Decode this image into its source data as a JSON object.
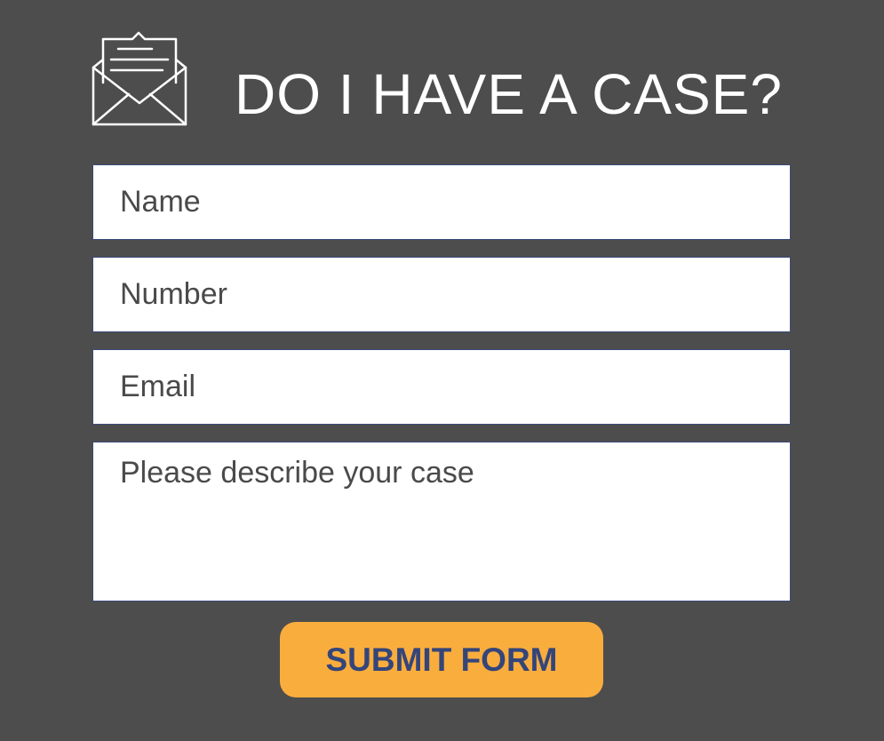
{
  "header": {
    "title": "DO I HAVE A CASE?",
    "icon": "open-envelope-icon"
  },
  "form": {
    "name_placeholder": "Name",
    "number_placeholder": "Number",
    "email_placeholder": "Email",
    "case_placeholder": "Please describe your case",
    "submit_label": "SUBMIT FORM"
  },
  "colors": {
    "background": "#4d4d4d",
    "field_border": "#3b4a7a",
    "button": "#f9ad3d",
    "button_text": "#34457a"
  }
}
